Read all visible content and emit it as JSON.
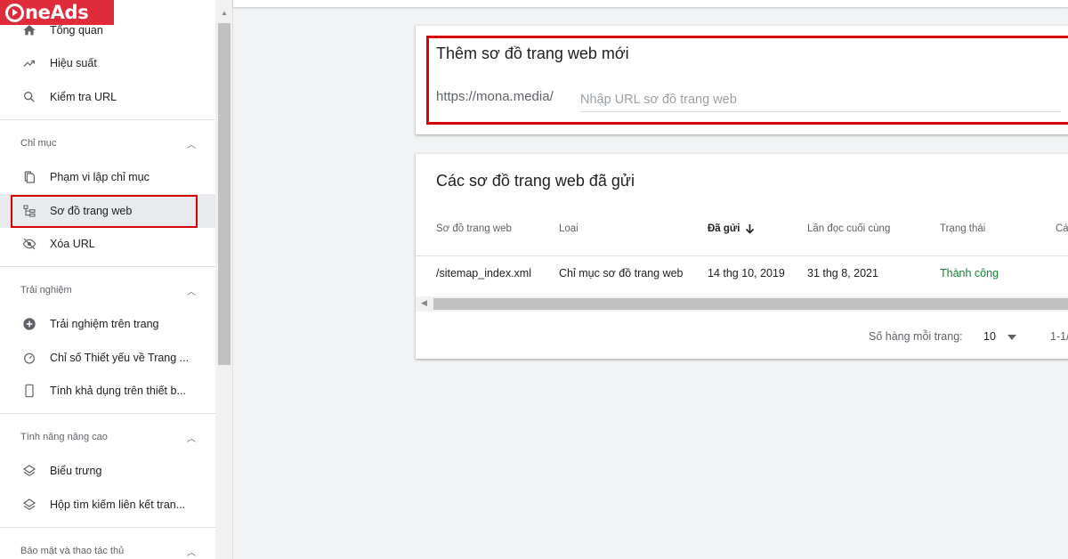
{
  "logo": {
    "text": "neAds"
  },
  "sidebar": {
    "items": [
      {
        "label": "Tổng quan",
        "icon": "home-icon"
      },
      {
        "label": "Hiệu suất",
        "icon": "trending-up-icon"
      },
      {
        "label": "Kiểm tra URL",
        "icon": "search-icon"
      }
    ],
    "sections": [
      {
        "title": "Chỉ mục",
        "items": [
          {
            "label": "Phạm vi lập chỉ mục",
            "icon": "copy-icon"
          },
          {
            "label": "Sơ đồ trang web",
            "icon": "sitemap-icon",
            "active": true
          },
          {
            "label": "Xóa URL",
            "icon": "eye-off-icon"
          }
        ]
      },
      {
        "title": "Trải nghiệm",
        "items": [
          {
            "label": "Trải nghiệm trên trang",
            "icon": "add-circle-icon"
          },
          {
            "label": "Chỉ số Thiết yếu về Trang ...",
            "icon": "speed-icon"
          },
          {
            "label": "Tính khả dụng trên thiết b...",
            "icon": "smartphone-icon"
          }
        ]
      },
      {
        "title": "Tính năng nâng cao",
        "items": [
          {
            "label": "Biểu trưng",
            "icon": "layers-icon"
          },
          {
            "label": "Hộp tìm kiếm liên kết tran...",
            "icon": "layers-icon"
          }
        ]
      },
      {
        "title": "Bảo mật và thao tác thủ"
      }
    ]
  },
  "add_sitemap": {
    "title": "Thêm sơ đồ trang web mới",
    "prefix": "https://mona.media/",
    "placeholder": "Nhập URL sơ đồ trang web",
    "value": ""
  },
  "submitted": {
    "title": "Các sơ đồ trang web đã gửi",
    "columns": [
      "Sơ đồ trang web",
      "Loại",
      "Đã gửi",
      "Lần đọc cuối cùng",
      "Trạng thái",
      "Cá"
    ],
    "sort_icon": "arrow-down-icon",
    "rows": [
      [
        "/sitemap_index.xml",
        "Chỉ mục sơ đồ trang web",
        "14 thg 10, 2019",
        "31 thg 8, 2021",
        "Thành công"
      ]
    ],
    "status_color": "#188038"
  },
  "pagination": {
    "rows_per_page_label": "Số hàng mỗi trang:",
    "rows_per_page_value": "10",
    "range": "1-1/"
  },
  "colors": {
    "highlight": "#d50000",
    "logo_bg": "#e02b3a",
    "active_item_bg": "#e8eaed"
  }
}
